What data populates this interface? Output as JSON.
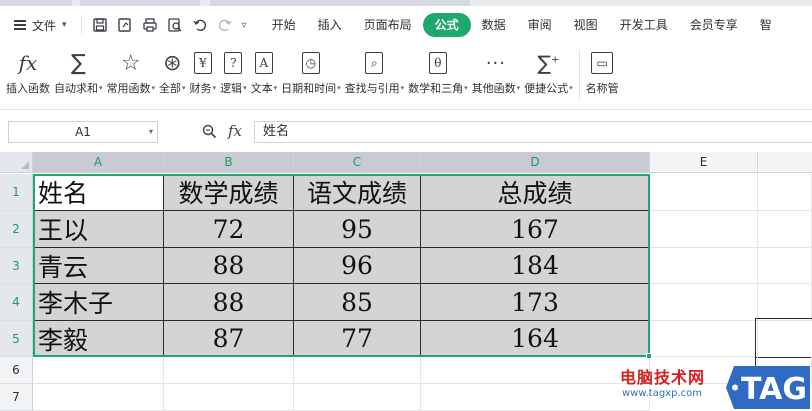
{
  "menubar": {
    "file_label": "文件",
    "tabs": [
      "开始",
      "插入",
      "页面布局",
      "公式",
      "数据",
      "审阅",
      "视图",
      "开发工具",
      "会员专享",
      "智"
    ],
    "active_tab": "公式",
    "accent_color": "#1ea86b"
  },
  "ribbon": {
    "buttons": [
      {
        "label": "插入函数",
        "icon": "function-fx-icon",
        "glyph": "fx",
        "dropdown": false
      },
      {
        "label": "自动求和",
        "icon": "sigma-icon",
        "glyph": "∑",
        "dropdown": true
      },
      {
        "label": "常用函数",
        "icon": "star-icon",
        "glyph": "☆",
        "dropdown": true
      },
      {
        "label": "全部",
        "icon": "asterisk-circle-icon",
        "glyph": "⊛",
        "dropdown": true
      },
      {
        "label": "财务",
        "icon": "yen-book-icon",
        "glyph": "¥",
        "dropdown": true
      },
      {
        "label": "逻辑",
        "icon": "question-book-icon",
        "glyph": "?",
        "dropdown": true
      },
      {
        "label": "文本",
        "icon": "text-a-book-icon",
        "glyph": "A",
        "dropdown": true
      },
      {
        "label": "日期和时间",
        "icon": "clock-book-icon",
        "glyph": "◷",
        "dropdown": true
      },
      {
        "label": "查找与引用",
        "icon": "search-book-icon",
        "glyph": "⌕",
        "dropdown": true
      },
      {
        "label": "数学和三角",
        "icon": "theta-book-icon",
        "glyph": "θ",
        "dropdown": true
      },
      {
        "label": "其他函数",
        "icon": "more-dots-icon",
        "glyph": "···",
        "dropdown": true
      },
      {
        "label": "便捷公式",
        "icon": "sigma-plus-icon",
        "glyph": "∑",
        "dropdown": true
      },
      {
        "label": "名称管",
        "icon": "name-manager-icon",
        "glyph": "▭",
        "dropdown": false
      }
    ]
  },
  "formula_bar": {
    "name_box": "A1",
    "fx_label": "fx",
    "content": "姓名"
  },
  "sheet": {
    "columns": [
      "A",
      "B",
      "C",
      "D",
      "E"
    ],
    "rows": [
      "1",
      "2",
      "3",
      "4",
      "5",
      "6",
      "7"
    ],
    "headers": [
      "姓名",
      "数学成绩",
      "语文成绩",
      "总成绩"
    ],
    "records": [
      [
        "王以",
        "72",
        "95",
        "167"
      ],
      [
        "青云",
        "88",
        "96",
        "184"
      ],
      [
        "李木子",
        "88",
        "85",
        "173"
      ],
      [
        "李毅",
        "87",
        "77",
        "164"
      ]
    ]
  },
  "watermark": {
    "title": "电脑技术网",
    "url": "www.tagxp.com",
    "logo_text": "TAG"
  }
}
